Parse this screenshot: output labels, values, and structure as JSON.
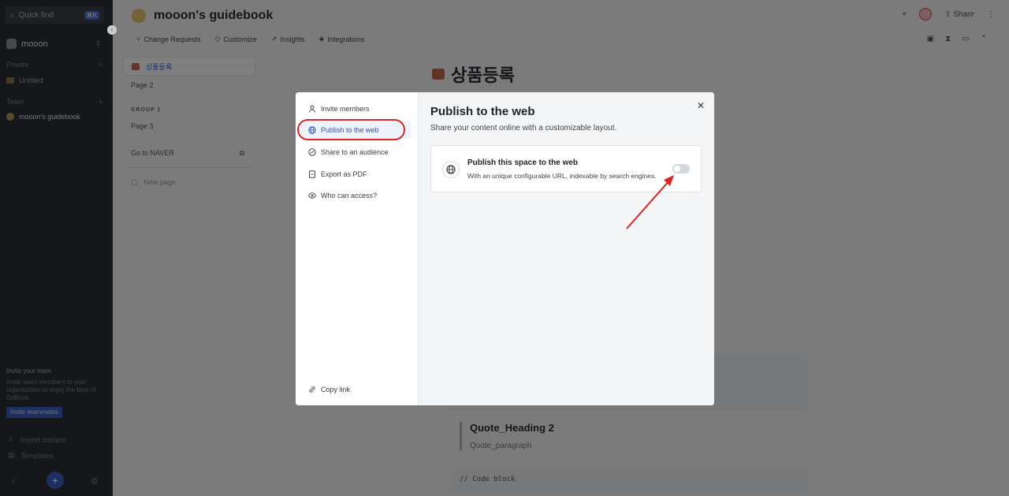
{
  "sidebar": {
    "quick_find": "Quick find",
    "shortcut": "⌘K",
    "org_name": "mooon",
    "private_label": "Private",
    "untitled": "Untitled",
    "team_label": "Team",
    "team_space": "mooon's guidebook",
    "invite_title": "Invite your team",
    "invite_text": "Invite team members to your organization to enjoy the best of GitBook.",
    "invite_button": "Invite teammates",
    "import_content": "Import content",
    "templates": "Templates"
  },
  "header": {
    "space_title": "mooon's guidebook",
    "share": "Share",
    "tabs": [
      "Change Requests",
      "Customize",
      "Insights",
      "Integrations"
    ]
  },
  "toc": {
    "items": [
      {
        "label": "상품등록"
      },
      {
        "label": "Page 2"
      }
    ],
    "group": "GROUP 1",
    "page3": "Page 3",
    "link": "Go to NAVER",
    "new_page": "New page"
  },
  "doc": {
    "title": "상품등록",
    "quote_heading": "Quote_Heading 2",
    "quote_paragraph": "Quote_paragraph",
    "code": "// Code block"
  },
  "modal": {
    "nav": [
      {
        "label": "Invite members",
        "icon": "person-icon"
      },
      {
        "label": "Publish to the web",
        "icon": "globe-icon"
      },
      {
        "label": "Share to an audience",
        "icon": "audience-icon"
      },
      {
        "label": "Export as PDF",
        "icon": "pdf-icon"
      },
      {
        "label": "Who can access?",
        "icon": "eye-icon"
      }
    ],
    "copy_link": "Copy link",
    "title": "Publish to the web",
    "subtitle": "Share your content online with a customizable layout.",
    "card_title": "Publish this space to the web",
    "card_desc": "With an unique configurable URL, indexable by search engines.",
    "toggle_on": false
  },
  "colors": {
    "accent": "#2f55b5",
    "annotation": "#d92525"
  }
}
